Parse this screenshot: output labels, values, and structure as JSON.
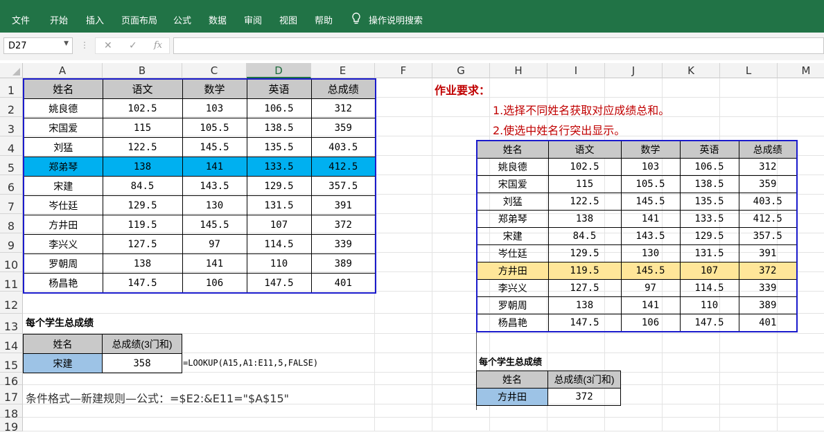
{
  "ribbon": {
    "tabs": [
      "文件",
      "开始",
      "插入",
      "页面布局",
      "公式",
      "数据",
      "审阅",
      "视图",
      "帮助"
    ],
    "search_label": "操作说明搜索"
  },
  "formula_bar": {
    "name_box": "D27",
    "cancel": "✕",
    "enter": "✓",
    "fx": "fx",
    "value": ""
  },
  "columns": [
    "A",
    "B",
    "C",
    "D",
    "E",
    "F",
    "G",
    "H",
    "I",
    "J",
    "K",
    "L",
    "M"
  ],
  "rows": [
    "1",
    "2",
    "3",
    "4",
    "5",
    "6",
    "7",
    "8",
    "9",
    "10",
    "11",
    "12",
    "13",
    "14",
    "15",
    "16",
    "17",
    "18",
    "19"
  ],
  "main_table": {
    "headers": [
      "姓名",
      "语文",
      "数学",
      "英语",
      "总成绩"
    ],
    "rows": [
      [
        "姚良德",
        "102.5",
        "103",
        "106.5",
        "312"
      ],
      [
        "宋国爱",
        "115",
        "105.5",
        "138.5",
        "359"
      ],
      [
        "刘猛",
        "122.5",
        "145.5",
        "135.5",
        "403.5"
      ],
      [
        "郑弟琴",
        "138",
        "141",
        "133.5",
        "412.5"
      ],
      [
        "宋建",
        "84.5",
        "143.5",
        "129.5",
        "357.5"
      ],
      [
        "岑仕廷",
        "129.5",
        "130",
        "131.5",
        "391"
      ],
      [
        "方井田",
        "119.5",
        "145.5",
        "107",
        "372"
      ],
      [
        "李兴义",
        "127.5",
        "97",
        "114.5",
        "339"
      ],
      [
        "罗朝周",
        "138",
        "141",
        "110",
        "389"
      ],
      [
        "杨昌艳",
        "147.5",
        "106",
        "147.5",
        "401"
      ]
    ]
  },
  "lookup": {
    "title": "每个学生总成绩",
    "headers": [
      "姓名",
      "总成绩(3门和)"
    ],
    "name": "宋建",
    "total": "358",
    "formula": "=LOOKUP(A15,A1:E11,5,FALSE)"
  },
  "conditional_format_note": "条件格式—新建规则—公式：=$E2:&E11=\"$A$15\"",
  "homework": {
    "title": "作业要求：",
    "item1": "1.选择不同姓名获取对应成绩总和。",
    "item2": "2.使选中姓名行突出显示。"
  },
  "example": {
    "headers": [
      "姓名",
      "语文",
      "数学",
      "英语",
      "总成绩"
    ],
    "rows": [
      [
        "姚良德",
        "102.5",
        "103",
        "106.5",
        "312"
      ],
      [
        "宋国爱",
        "115",
        "105.5",
        "138.5",
        "359"
      ],
      [
        "刘猛",
        "122.5",
        "145.5",
        "135.5",
        "403.5"
      ],
      [
        "郑弟琴",
        "138",
        "141",
        "133.5",
        "412.5"
      ],
      [
        "宋建",
        "84.5",
        "143.5",
        "129.5",
        "357.5"
      ],
      [
        "岑仕廷",
        "129.5",
        "130",
        "131.5",
        "391"
      ],
      [
        "方井田",
        "119.5",
        "145.5",
        "107",
        "372"
      ],
      [
        "李兴义",
        "127.5",
        "97",
        "114.5",
        "339"
      ],
      [
        "罗朝周",
        "138",
        "141",
        "110",
        "389"
      ],
      [
        "杨昌艳",
        "147.5",
        "106",
        "147.5",
        "401"
      ]
    ],
    "lookup_title": "每个学生总成绩",
    "lookup_headers": [
      "姓名",
      "总成绩(3门和)"
    ],
    "lookup_name": "方井田",
    "lookup_total": "372"
  },
  "colors": {
    "ribbon": "#217346",
    "highlight_main": "#00b0f0",
    "highlight_example": "#ffe699",
    "name_cell": "#9dc3e6",
    "homework_text": "#c00000"
  }
}
